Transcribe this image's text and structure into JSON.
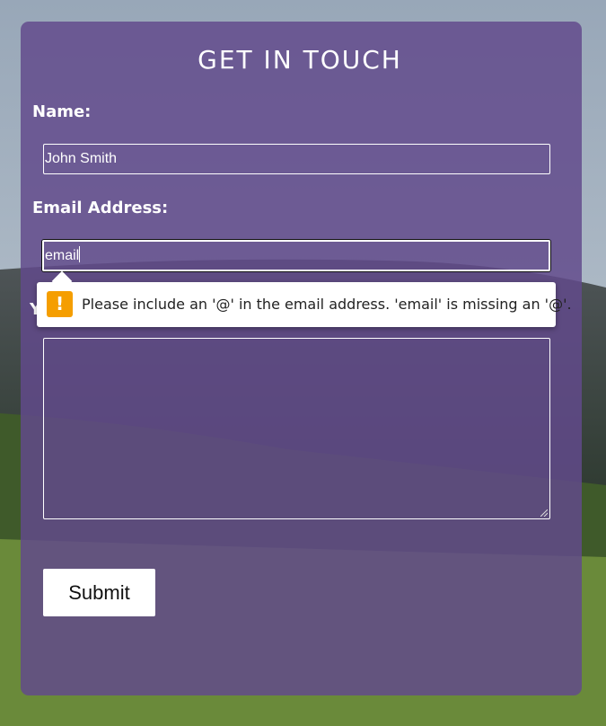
{
  "form": {
    "title": "GET IN TOUCH",
    "name_label": "Name:",
    "name_value": "John Smith",
    "email_label": "Email Address:",
    "email_value": "email",
    "message_label_partial": "Y",
    "submit_label": "Submit"
  },
  "validation": {
    "message": "Please include an '@' in the email address. 'email' is missing an '@'.",
    "icon": "warning-icon",
    "icon_glyph": "!"
  },
  "colors": {
    "panel": "#624a8c",
    "warning": "#f59e00",
    "text": "#ffffff"
  }
}
